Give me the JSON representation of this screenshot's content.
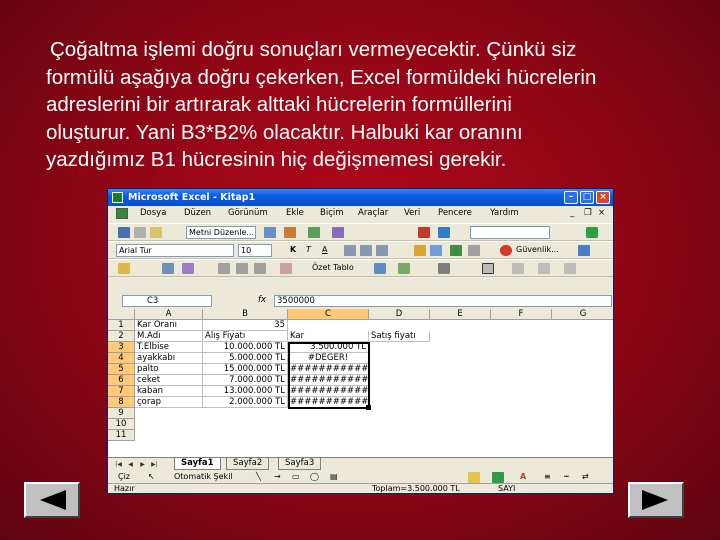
{
  "slide": {
    "lines": [
      "Çoğaltma işlemi doğru sonuçları vermeyecektir. Çünkü siz",
      "formülü aşağıya doğru çekerken, Excel formüldeki hücrelerin",
      "adreslerini bir artırarak alttaki hücrelerin formüllerini",
      "oluşturur. Yani B3*B2% olacaktır. Halbuki kar oranını",
      "yazdığımız B1 hücresinin hiç değişmemesi gerekir."
    ]
  },
  "excel": {
    "title": "Microsoft Excel - Kitap1",
    "menu": [
      "Dosya",
      "Düzen",
      "Görünüm",
      "Ekle",
      "Biçim",
      "Araçlar",
      "Veri",
      "Pencere",
      "Yardım"
    ],
    "toolbar1": {
      "search_box": "Metni Düzenle..."
    },
    "toolbar2": {
      "font": "Arial Tur",
      "size": "10",
      "bold": "K",
      "italic": "T",
      "underline": "A",
      "security": "Güvenlik..."
    },
    "toolbar3": {
      "autoformat": "Özet Tablo"
    },
    "namebox": "C3",
    "fx": "fx",
    "formula": "3500000",
    "columns": [
      "A",
      "B",
      "C",
      "D",
      "E",
      "F",
      "G"
    ],
    "rows": [
      "1",
      "2",
      "3",
      "4",
      "5",
      "6",
      "7",
      "8",
      "9",
      "10",
      "11"
    ],
    "cells": {
      "a1": "Kar Oranı",
      "b1": "35",
      "a2": "M.Adı",
      "b2": "Alış Fiyatı",
      "c2": "Kar",
      "d2": "Satış fiyatı",
      "a3": "T.Elbise",
      "b3": "10.000.000 TL",
      "c3": "3.500.000 TL",
      "a4": "ayakkabı",
      "b4": "5.000.000 TL",
      "c4": "#DEĞER!",
      "a5": "palto",
      "b5": "15.000.000 TL",
      "c5": "############",
      "a6": "ceket",
      "b6": "7.000.000 TL",
      "c6": "############",
      "a7": "kaban",
      "b7": "13.000.000 TL",
      "c7": "############",
      "a8": "çorap",
      "b8": "2.000.000 TL",
      "c8": "############"
    },
    "sheets": [
      "Sayfa1",
      "Sayfa2",
      "Sayfa3"
    ],
    "drawing": {
      "draw": "Çiz",
      "autoshapes": "Otomatik Şekil"
    },
    "status": {
      "ready": "Hazır",
      "sum": "Toplam=3.500.000 TL",
      "num": "SAYI"
    }
  },
  "colors": {
    "background": "#9b0718",
    "titlebar": "#0a5ce2",
    "selected_header": "#ffc978"
  }
}
